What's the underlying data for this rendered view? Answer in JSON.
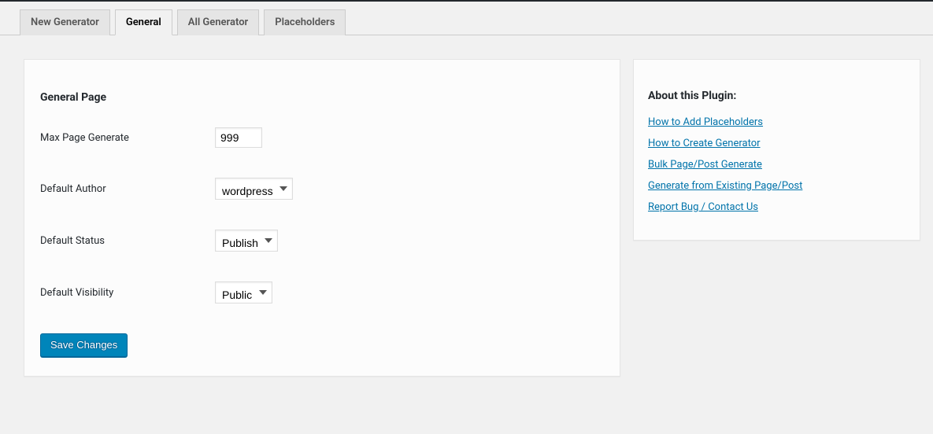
{
  "tabs": {
    "new_generator": "New Generator",
    "general": "General",
    "all_generator": "All Generator",
    "placeholders": "Placeholders"
  },
  "main": {
    "heading": "General Page",
    "fields": {
      "max_page_label": "Max Page Generate",
      "max_page_value": "999",
      "default_author_label": "Default Author",
      "default_author_value": "wordpress",
      "default_status_label": "Default Status",
      "default_status_value": "Publish",
      "default_visibility_label": "Default Visibility",
      "default_visibility_value": "Public"
    },
    "submit_label": "Save Changes"
  },
  "sidebar": {
    "heading": "About this Plugin:",
    "links": [
      "How to Add Placeholders",
      "How to Create Generator",
      "Bulk Page/Post Generate",
      "Generate from Existing Page/Post",
      "Report Bug / Contact Us"
    ]
  }
}
